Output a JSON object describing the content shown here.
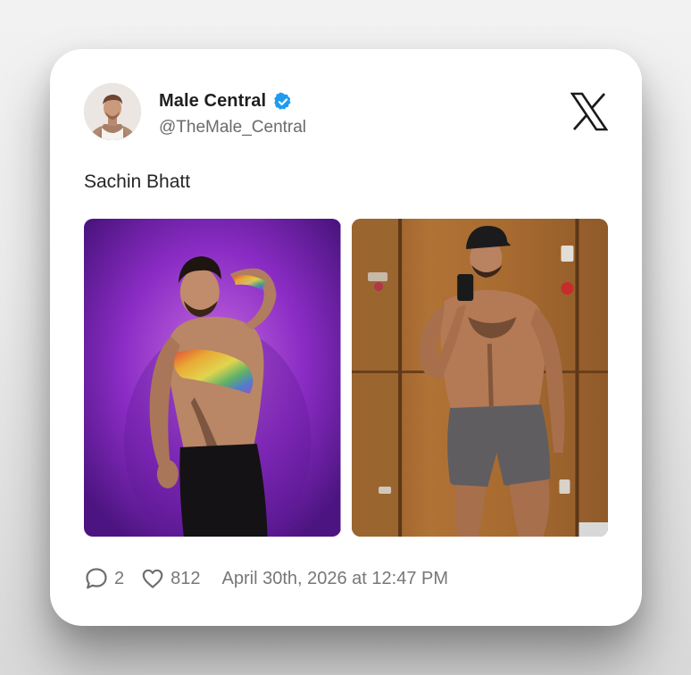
{
  "author": {
    "display_name": "Male Central",
    "handle": "@TheMale_Central",
    "verified_icon": "verified-badge-icon",
    "verified_color": "#1d9bf0"
  },
  "platform_icon": "x-logo-icon",
  "tweet": {
    "text": "Sachin Bhatt"
  },
  "media": [
    {
      "name": "photo-purple-background",
      "icon": "photo"
    },
    {
      "name": "photo-locker-mirror-selfie",
      "icon": "photo"
    }
  ],
  "footer": {
    "reply_icon": "comment-icon",
    "reply_count": "2",
    "like_icon": "heart-icon",
    "like_count": "812",
    "timestamp": "April 30th, 2026 at 12:47 PM"
  }
}
